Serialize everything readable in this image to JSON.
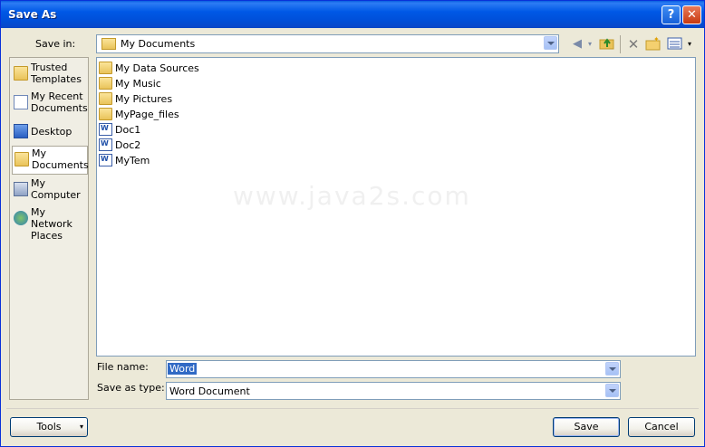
{
  "window": {
    "title": "Save As"
  },
  "titlebar": {
    "help_label": "?",
    "close_label": "✕"
  },
  "save_in": {
    "label": "Save in:",
    "value": "My Documents",
    "icon": "my-documents-icon"
  },
  "toolbar": {
    "back_icon": "back-icon",
    "up_folder_icon": "up-one-level-icon",
    "delete_icon": "delete-icon",
    "new_folder_icon": "new-folder-icon",
    "views_icon": "views-icon"
  },
  "places": [
    {
      "label": "Trusted Templates",
      "icon": "folder-icon"
    },
    {
      "label": "My Recent Documents",
      "icon": "recent-documents-icon"
    },
    {
      "label": "Desktop",
      "icon": "desktop-icon"
    },
    {
      "label": "My Documents",
      "icon": "my-documents-icon",
      "selected": true
    },
    {
      "label": "My Computer",
      "icon": "my-computer-icon"
    },
    {
      "label": "My Network Places",
      "icon": "network-places-icon"
    }
  ],
  "files": [
    {
      "name": "My Data Sources",
      "type": "folder"
    },
    {
      "name": "My Music",
      "type": "folder"
    },
    {
      "name": "My Pictures",
      "type": "folder"
    },
    {
      "name": "MyPage_files",
      "type": "folder"
    },
    {
      "name": "Doc1",
      "type": "word-document"
    },
    {
      "name": "Doc2",
      "type": "word-document"
    },
    {
      "name": "MyTem",
      "type": "word-document"
    }
  ],
  "watermark": "www.java2s.com",
  "file_name": {
    "label": "File name:",
    "value": "Word"
  },
  "save_as_type": {
    "label": "Save as type:",
    "value": "Word Document"
  },
  "buttons": {
    "tools": "Tools",
    "save": "Save",
    "cancel": "Cancel"
  },
  "colors": {
    "title_bar": "#0058e6",
    "dialog_bg": "#ece9d8",
    "selection": "#316ac5"
  }
}
